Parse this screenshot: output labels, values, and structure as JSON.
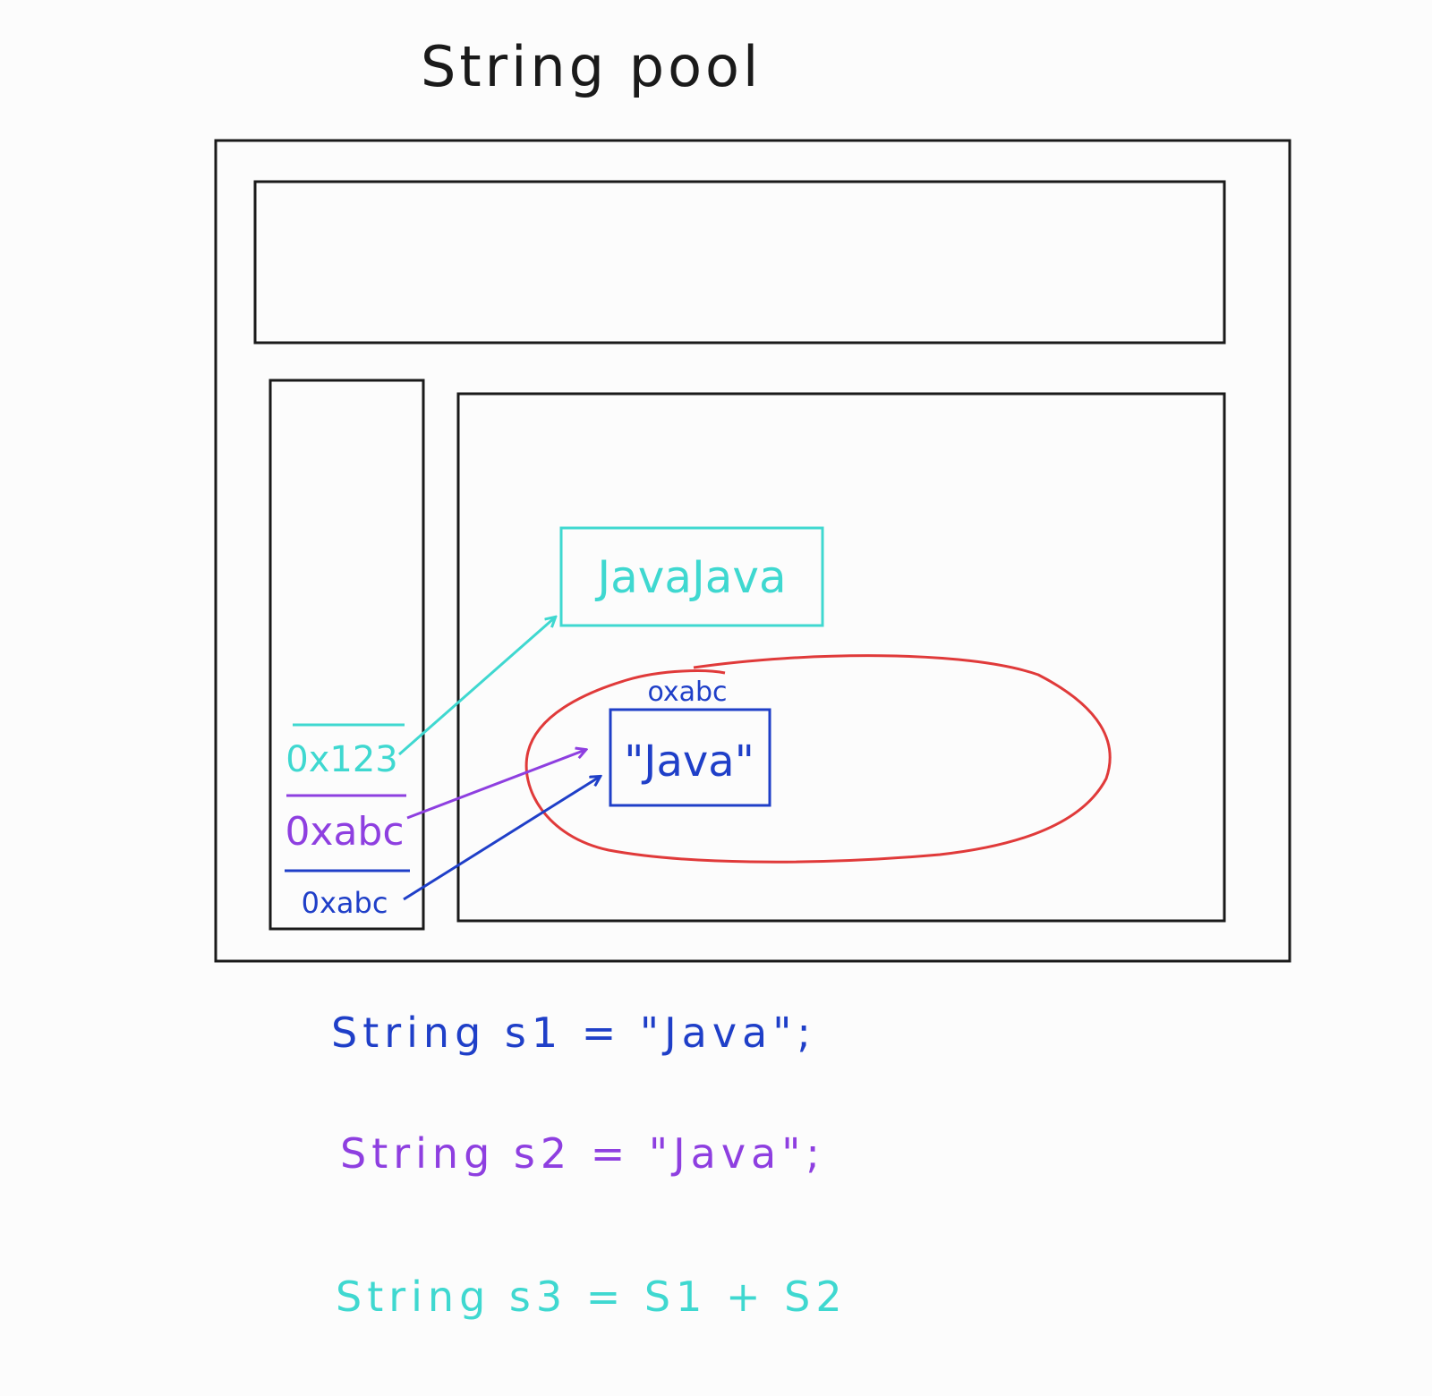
{
  "title": "String pool",
  "stack": {
    "entries": [
      {
        "address": "0x123",
        "color": "#3fd8d0"
      },
      {
        "address": "0xabc",
        "color": "#8e3fe0"
      },
      {
        "address": "0xabc",
        "color": "#1f3fc8"
      }
    ]
  },
  "heap": {
    "concat_object": {
      "value": "JavaJava",
      "color": "#3fd8d0"
    },
    "pool_object": {
      "value": "\"Java\"",
      "address": "oxabc",
      "color": "#1f3fc8"
    },
    "pool_outline_color": "#e03a3a"
  },
  "code_lines": [
    {
      "text": "String s1 = \"Java\";",
      "color": "#1f3fc8"
    },
    {
      "text": "String s2 = \"Java\";",
      "color": "#8e3fe0"
    },
    {
      "text": "String s3 = S1 + S2",
      "color": "#3fd8d0"
    }
  ],
  "colors": {
    "outline": "#1a1a1a",
    "background": "#fcfcfc"
  }
}
